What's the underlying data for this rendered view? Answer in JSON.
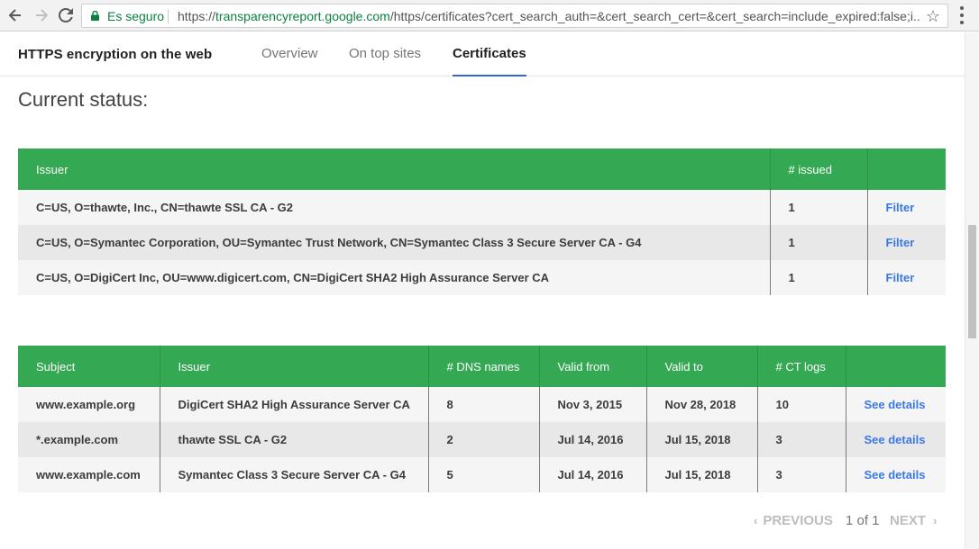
{
  "browser": {
    "secure_label": "Es seguro",
    "url_scheme": "https://",
    "url_host": "transparencyreport.google.com",
    "url_path": "/https/certificates?cert_search_auth=&cert_search_cert=&cert_search=include_expired:false;i..."
  },
  "header": {
    "title": "HTTPS encryption on the web",
    "tabs": [
      {
        "label": "Overview"
      },
      {
        "label": "On top sites"
      },
      {
        "label": "Certificates"
      }
    ]
  },
  "status_heading": "Current status:",
  "issuer_table": {
    "columns": [
      "Issuer",
      "# issued",
      ""
    ],
    "rows": [
      {
        "issuer": "C=US, O=thawte, Inc., CN=thawte SSL CA - G2",
        "issued": "1",
        "action": "Filter"
      },
      {
        "issuer": "C=US, O=Symantec Corporation, OU=Symantec Trust Network, CN=Symantec Class 3 Secure Server CA - G4",
        "issued": "1",
        "action": "Filter"
      },
      {
        "issuer": "C=US, O=DigiCert Inc, OU=www.digicert.com, CN=DigiCert SHA2 High Assurance Server CA",
        "issued": "1",
        "action": "Filter"
      }
    ]
  },
  "cert_table": {
    "columns": [
      "Subject",
      "Issuer",
      "# DNS names",
      "Valid from",
      "Valid to",
      "# CT logs",
      ""
    ],
    "rows": [
      {
        "subject": "www.example.org",
        "issuer": "DigiCert SHA2 High Assurance Server CA",
        "dns": "8",
        "from": "Nov 3, 2015",
        "to": "Nov 28, 2018",
        "ct": "10",
        "action": "See details"
      },
      {
        "subject": "*.example.com",
        "issuer": "thawte SSL CA - G2",
        "dns": "2",
        "from": "Jul 14, 2016",
        "to": "Jul 15, 2018",
        "ct": "3",
        "action": "See details"
      },
      {
        "subject": "www.example.com",
        "issuer": "Symantec Class 3 Secure Server CA - G4",
        "dns": "5",
        "from": "Jul 14, 2016",
        "to": "Jul 15, 2018",
        "ct": "3",
        "action": "See details"
      }
    ]
  },
  "pagination": {
    "previous_label": "PREVIOUS",
    "count_label": "1 of 1",
    "next_label": "NEXT"
  },
  "colors": {
    "table_header": "#34a853",
    "link": "#3b78e7",
    "secure": "#0b8043",
    "active_tab_underline": "#3367d6"
  },
  "icons": [
    "back-arrow-icon",
    "forward-arrow-icon",
    "reload-icon",
    "lock-icon",
    "star-icon",
    "menu-dots-icon",
    "chevron-left-icon",
    "chevron-right-icon"
  ]
}
